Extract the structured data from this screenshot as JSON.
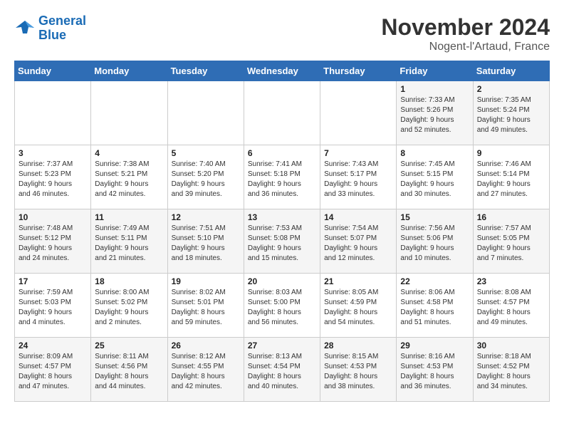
{
  "header": {
    "logo_line1": "General",
    "logo_line2": "Blue",
    "month": "November 2024",
    "location": "Nogent-l'Artaud, France"
  },
  "weekdays": [
    "Sunday",
    "Monday",
    "Tuesday",
    "Wednesday",
    "Thursday",
    "Friday",
    "Saturday"
  ],
  "weeks": [
    [
      {
        "day": "",
        "info": ""
      },
      {
        "day": "",
        "info": ""
      },
      {
        "day": "",
        "info": ""
      },
      {
        "day": "",
        "info": ""
      },
      {
        "day": "",
        "info": ""
      },
      {
        "day": "1",
        "info": "Sunrise: 7:33 AM\nSunset: 5:26 PM\nDaylight: 9 hours\nand 52 minutes."
      },
      {
        "day": "2",
        "info": "Sunrise: 7:35 AM\nSunset: 5:24 PM\nDaylight: 9 hours\nand 49 minutes."
      }
    ],
    [
      {
        "day": "3",
        "info": "Sunrise: 7:37 AM\nSunset: 5:23 PM\nDaylight: 9 hours\nand 46 minutes."
      },
      {
        "day": "4",
        "info": "Sunrise: 7:38 AM\nSunset: 5:21 PM\nDaylight: 9 hours\nand 42 minutes."
      },
      {
        "day": "5",
        "info": "Sunrise: 7:40 AM\nSunset: 5:20 PM\nDaylight: 9 hours\nand 39 minutes."
      },
      {
        "day": "6",
        "info": "Sunrise: 7:41 AM\nSunset: 5:18 PM\nDaylight: 9 hours\nand 36 minutes."
      },
      {
        "day": "7",
        "info": "Sunrise: 7:43 AM\nSunset: 5:17 PM\nDaylight: 9 hours\nand 33 minutes."
      },
      {
        "day": "8",
        "info": "Sunrise: 7:45 AM\nSunset: 5:15 PM\nDaylight: 9 hours\nand 30 minutes."
      },
      {
        "day": "9",
        "info": "Sunrise: 7:46 AM\nSunset: 5:14 PM\nDaylight: 9 hours\nand 27 minutes."
      }
    ],
    [
      {
        "day": "10",
        "info": "Sunrise: 7:48 AM\nSunset: 5:12 PM\nDaylight: 9 hours\nand 24 minutes."
      },
      {
        "day": "11",
        "info": "Sunrise: 7:49 AM\nSunset: 5:11 PM\nDaylight: 9 hours\nand 21 minutes."
      },
      {
        "day": "12",
        "info": "Sunrise: 7:51 AM\nSunset: 5:10 PM\nDaylight: 9 hours\nand 18 minutes."
      },
      {
        "day": "13",
        "info": "Sunrise: 7:53 AM\nSunset: 5:08 PM\nDaylight: 9 hours\nand 15 minutes."
      },
      {
        "day": "14",
        "info": "Sunrise: 7:54 AM\nSunset: 5:07 PM\nDaylight: 9 hours\nand 12 minutes."
      },
      {
        "day": "15",
        "info": "Sunrise: 7:56 AM\nSunset: 5:06 PM\nDaylight: 9 hours\nand 10 minutes."
      },
      {
        "day": "16",
        "info": "Sunrise: 7:57 AM\nSunset: 5:05 PM\nDaylight: 9 hours\nand 7 minutes."
      }
    ],
    [
      {
        "day": "17",
        "info": "Sunrise: 7:59 AM\nSunset: 5:03 PM\nDaylight: 9 hours\nand 4 minutes."
      },
      {
        "day": "18",
        "info": "Sunrise: 8:00 AM\nSunset: 5:02 PM\nDaylight: 9 hours\nand 2 minutes."
      },
      {
        "day": "19",
        "info": "Sunrise: 8:02 AM\nSunset: 5:01 PM\nDaylight: 8 hours\nand 59 minutes."
      },
      {
        "day": "20",
        "info": "Sunrise: 8:03 AM\nSunset: 5:00 PM\nDaylight: 8 hours\nand 56 minutes."
      },
      {
        "day": "21",
        "info": "Sunrise: 8:05 AM\nSunset: 4:59 PM\nDaylight: 8 hours\nand 54 minutes."
      },
      {
        "day": "22",
        "info": "Sunrise: 8:06 AM\nSunset: 4:58 PM\nDaylight: 8 hours\nand 51 minutes."
      },
      {
        "day": "23",
        "info": "Sunrise: 8:08 AM\nSunset: 4:57 PM\nDaylight: 8 hours\nand 49 minutes."
      }
    ],
    [
      {
        "day": "24",
        "info": "Sunrise: 8:09 AM\nSunset: 4:57 PM\nDaylight: 8 hours\nand 47 minutes."
      },
      {
        "day": "25",
        "info": "Sunrise: 8:11 AM\nSunset: 4:56 PM\nDaylight: 8 hours\nand 44 minutes."
      },
      {
        "day": "26",
        "info": "Sunrise: 8:12 AM\nSunset: 4:55 PM\nDaylight: 8 hours\nand 42 minutes."
      },
      {
        "day": "27",
        "info": "Sunrise: 8:13 AM\nSunset: 4:54 PM\nDaylight: 8 hours\nand 40 minutes."
      },
      {
        "day": "28",
        "info": "Sunrise: 8:15 AM\nSunset: 4:53 PM\nDaylight: 8 hours\nand 38 minutes."
      },
      {
        "day": "29",
        "info": "Sunrise: 8:16 AM\nSunset: 4:53 PM\nDaylight: 8 hours\nand 36 minutes."
      },
      {
        "day": "30",
        "info": "Sunrise: 8:18 AM\nSunset: 4:52 PM\nDaylight: 8 hours\nand 34 minutes."
      }
    ]
  ]
}
